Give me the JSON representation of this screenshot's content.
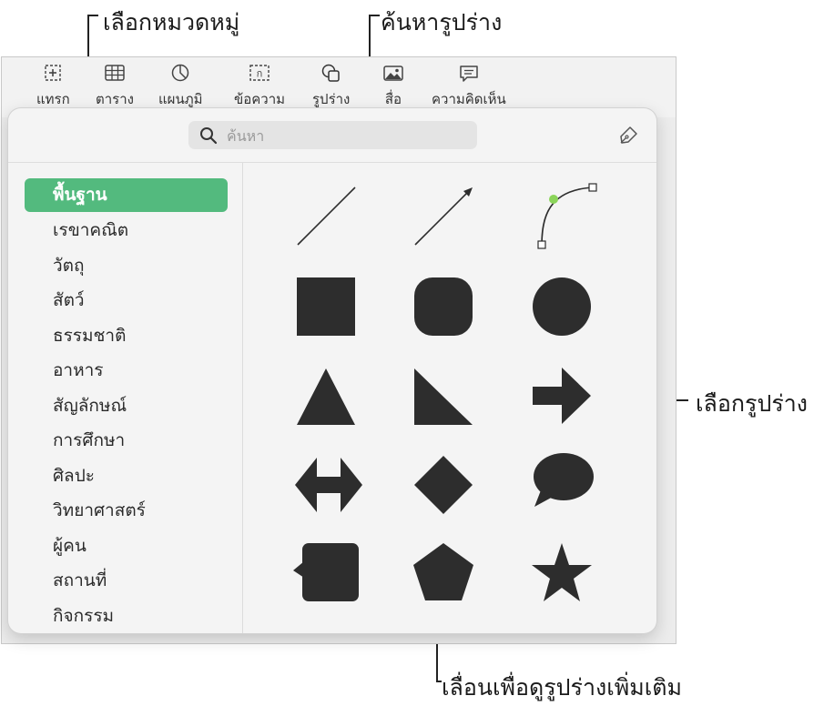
{
  "callouts": {
    "choose_category": "เลือกหมวดหมู่",
    "search_shapes": "ค้นหารูปร่าง",
    "choose_shape": "เลือกรูปร่าง",
    "scroll_more": "เลื่อนเพื่อดูรูปร่างเพิ่มเติม"
  },
  "toolbar": {
    "items": [
      {
        "label": "แทรก",
        "icon": "insert-icon"
      },
      {
        "label": "ตาราง",
        "icon": "table-icon"
      },
      {
        "label": "แผนภูมิ",
        "icon": "chart-icon"
      },
      {
        "label": "ข้อความ",
        "icon": "text-box-icon"
      },
      {
        "label": "รูปร่าง",
        "icon": "shapes-icon",
        "active": true
      },
      {
        "label": "สื่อ",
        "icon": "media-icon"
      },
      {
        "label": "ความคิดเห็น",
        "icon": "comment-icon"
      }
    ]
  },
  "popover": {
    "search_placeholder": "ค้นหา",
    "categories": [
      {
        "label": "พื้นฐาน",
        "selected": true
      },
      {
        "label": "เรขาคณิต"
      },
      {
        "label": "วัตถุ"
      },
      {
        "label": "สัตว์"
      },
      {
        "label": "ธรรมชาติ"
      },
      {
        "label": "อาหาร"
      },
      {
        "label": "สัญลักษณ์"
      },
      {
        "label": "การศึกษา"
      },
      {
        "label": "ศิลปะ"
      },
      {
        "label": "วิทยาศาสตร์"
      },
      {
        "label": "ผู้คน"
      },
      {
        "label": "สถานที่"
      },
      {
        "label": "กิจกรรม"
      }
    ],
    "shapes": [
      "line",
      "arrow-line",
      "curve",
      "square",
      "rounded-square",
      "circle",
      "triangle",
      "right-triangle",
      "arrow-right",
      "double-arrow",
      "diamond",
      "speech-bubble",
      "callout-square",
      "pentagon",
      "star"
    ]
  },
  "colors": {
    "accent": "#53ba7e",
    "shape_fill": "#2d2d2d",
    "curve_point": "#8bd45a"
  }
}
